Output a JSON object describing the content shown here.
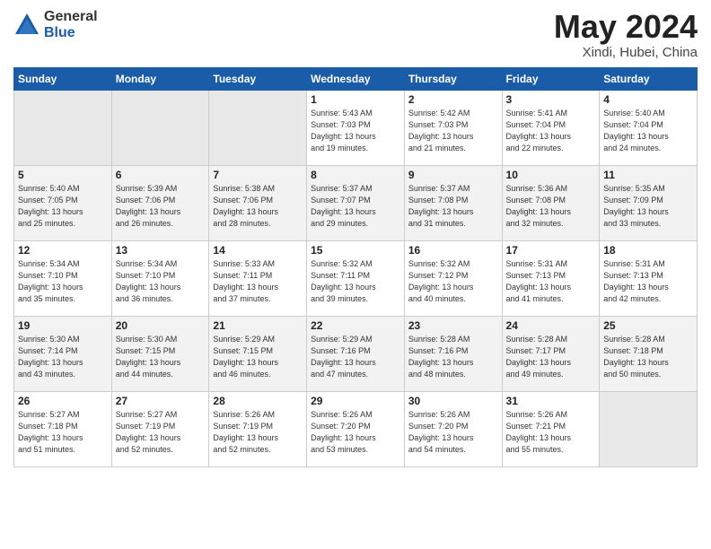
{
  "logo": {
    "general": "General",
    "blue": "Blue"
  },
  "header": {
    "title": "May 2024",
    "subtitle": "Xindi, Hubei, China"
  },
  "weekdays": [
    "Sunday",
    "Monday",
    "Tuesday",
    "Wednesday",
    "Thursday",
    "Friday",
    "Saturday"
  ],
  "weeks": [
    [
      {
        "day": "",
        "info": ""
      },
      {
        "day": "",
        "info": ""
      },
      {
        "day": "",
        "info": ""
      },
      {
        "day": "1",
        "info": "Sunrise: 5:43 AM\nSunset: 7:03 PM\nDaylight: 13 hours\nand 19 minutes."
      },
      {
        "day": "2",
        "info": "Sunrise: 5:42 AM\nSunset: 7:03 PM\nDaylight: 13 hours\nand 21 minutes."
      },
      {
        "day": "3",
        "info": "Sunrise: 5:41 AM\nSunset: 7:04 PM\nDaylight: 13 hours\nand 22 minutes."
      },
      {
        "day": "4",
        "info": "Sunrise: 5:40 AM\nSunset: 7:04 PM\nDaylight: 13 hours\nand 24 minutes."
      }
    ],
    [
      {
        "day": "5",
        "info": "Sunrise: 5:40 AM\nSunset: 7:05 PM\nDaylight: 13 hours\nand 25 minutes."
      },
      {
        "day": "6",
        "info": "Sunrise: 5:39 AM\nSunset: 7:06 PM\nDaylight: 13 hours\nand 26 minutes."
      },
      {
        "day": "7",
        "info": "Sunrise: 5:38 AM\nSunset: 7:06 PM\nDaylight: 13 hours\nand 28 minutes."
      },
      {
        "day": "8",
        "info": "Sunrise: 5:37 AM\nSunset: 7:07 PM\nDaylight: 13 hours\nand 29 minutes."
      },
      {
        "day": "9",
        "info": "Sunrise: 5:37 AM\nSunset: 7:08 PM\nDaylight: 13 hours\nand 31 minutes."
      },
      {
        "day": "10",
        "info": "Sunrise: 5:36 AM\nSunset: 7:08 PM\nDaylight: 13 hours\nand 32 minutes."
      },
      {
        "day": "11",
        "info": "Sunrise: 5:35 AM\nSunset: 7:09 PM\nDaylight: 13 hours\nand 33 minutes."
      }
    ],
    [
      {
        "day": "12",
        "info": "Sunrise: 5:34 AM\nSunset: 7:10 PM\nDaylight: 13 hours\nand 35 minutes."
      },
      {
        "day": "13",
        "info": "Sunrise: 5:34 AM\nSunset: 7:10 PM\nDaylight: 13 hours\nand 36 minutes."
      },
      {
        "day": "14",
        "info": "Sunrise: 5:33 AM\nSunset: 7:11 PM\nDaylight: 13 hours\nand 37 minutes."
      },
      {
        "day": "15",
        "info": "Sunrise: 5:32 AM\nSunset: 7:11 PM\nDaylight: 13 hours\nand 39 minutes."
      },
      {
        "day": "16",
        "info": "Sunrise: 5:32 AM\nSunset: 7:12 PM\nDaylight: 13 hours\nand 40 minutes."
      },
      {
        "day": "17",
        "info": "Sunrise: 5:31 AM\nSunset: 7:13 PM\nDaylight: 13 hours\nand 41 minutes."
      },
      {
        "day": "18",
        "info": "Sunrise: 5:31 AM\nSunset: 7:13 PM\nDaylight: 13 hours\nand 42 minutes."
      }
    ],
    [
      {
        "day": "19",
        "info": "Sunrise: 5:30 AM\nSunset: 7:14 PM\nDaylight: 13 hours\nand 43 minutes."
      },
      {
        "day": "20",
        "info": "Sunrise: 5:30 AM\nSunset: 7:15 PM\nDaylight: 13 hours\nand 44 minutes."
      },
      {
        "day": "21",
        "info": "Sunrise: 5:29 AM\nSunset: 7:15 PM\nDaylight: 13 hours\nand 46 minutes."
      },
      {
        "day": "22",
        "info": "Sunrise: 5:29 AM\nSunset: 7:16 PM\nDaylight: 13 hours\nand 47 minutes."
      },
      {
        "day": "23",
        "info": "Sunrise: 5:28 AM\nSunset: 7:16 PM\nDaylight: 13 hours\nand 48 minutes."
      },
      {
        "day": "24",
        "info": "Sunrise: 5:28 AM\nSunset: 7:17 PM\nDaylight: 13 hours\nand 49 minutes."
      },
      {
        "day": "25",
        "info": "Sunrise: 5:28 AM\nSunset: 7:18 PM\nDaylight: 13 hours\nand 50 minutes."
      }
    ],
    [
      {
        "day": "26",
        "info": "Sunrise: 5:27 AM\nSunset: 7:18 PM\nDaylight: 13 hours\nand 51 minutes."
      },
      {
        "day": "27",
        "info": "Sunrise: 5:27 AM\nSunset: 7:19 PM\nDaylight: 13 hours\nand 52 minutes."
      },
      {
        "day": "28",
        "info": "Sunrise: 5:26 AM\nSunset: 7:19 PM\nDaylight: 13 hours\nand 52 minutes."
      },
      {
        "day": "29",
        "info": "Sunrise: 5:26 AM\nSunset: 7:20 PM\nDaylight: 13 hours\nand 53 minutes."
      },
      {
        "day": "30",
        "info": "Sunrise: 5:26 AM\nSunset: 7:20 PM\nDaylight: 13 hours\nand 54 minutes."
      },
      {
        "day": "31",
        "info": "Sunrise: 5:26 AM\nSunset: 7:21 PM\nDaylight: 13 hours\nand 55 minutes."
      },
      {
        "day": "",
        "info": ""
      }
    ]
  ]
}
